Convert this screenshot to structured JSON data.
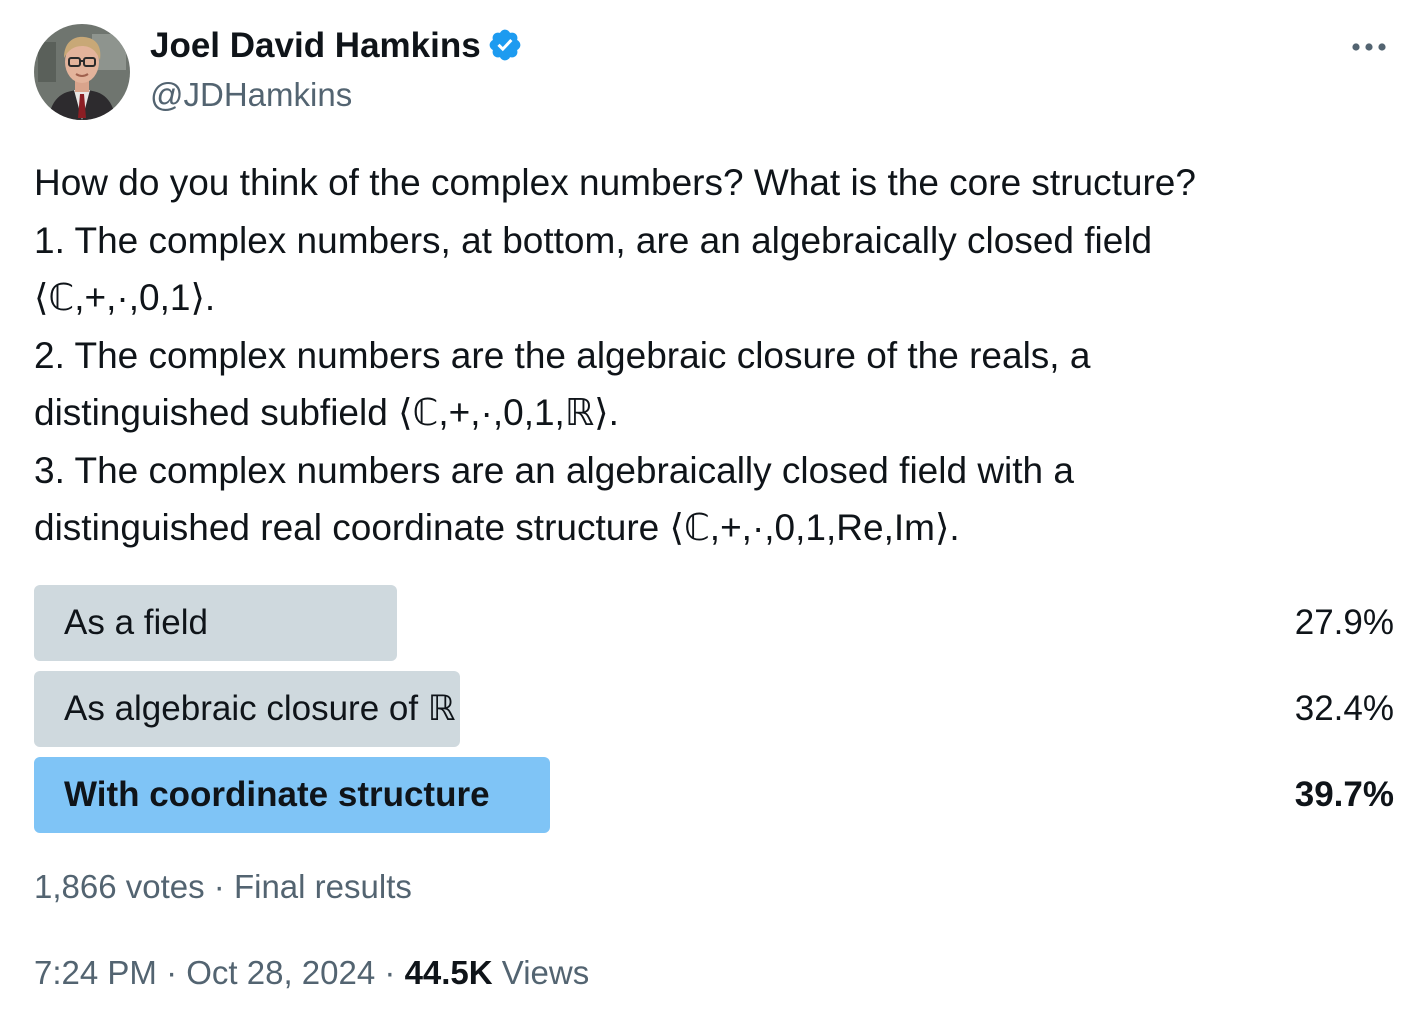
{
  "author": {
    "display_name": "Joel David Hamkins",
    "handle": "@JDHamkins",
    "verified": true
  },
  "tweet": {
    "lines": [
      "How do you think of the complex numbers? What is the core structure?",
      "1. The complex numbers, at bottom, are an algebraically closed field",
      "⟨ℂ,+,·,0,1⟩.",
      "2. The complex numbers are the algebraic closure of the reals, a",
      "distinguished subfield ⟨ℂ,+,·,0,1,ℝ⟩.",
      "3. The complex numbers are an algebraically closed field with a",
      "distinguished real coordinate structure ⟨ℂ,+,·,0,1,Re,Im⟩."
    ]
  },
  "poll": {
    "options": [
      {
        "label": "As a field",
        "percent_text": "27.9%",
        "percent": 27.9,
        "winner": false
      },
      {
        "label": "As algebraic closure of ℝ",
        "percent_text": "32.4%",
        "percent": 32.4,
        "winner": false
      },
      {
        "label": "With coordinate structure",
        "percent_text": "39.7%",
        "percent": 39.7,
        "winner": true
      }
    ],
    "votes": "1,866 votes",
    "separator": "·",
    "status": "Final results"
  },
  "meta": {
    "time": "7:24 PM",
    "date": "Oct 28, 2024",
    "separator": "·",
    "views_count": "44.5K",
    "views_label": "Views"
  },
  "colors": {
    "text_primary": "#0f1419",
    "text_secondary": "#536471",
    "poll_bar": "#cfd9de",
    "poll_bar_winner": "#7fc4f6",
    "verified_badge": "#1d9bf0"
  },
  "icons": {
    "verified": "verified-badge-icon",
    "more": "more-options-icon"
  }
}
